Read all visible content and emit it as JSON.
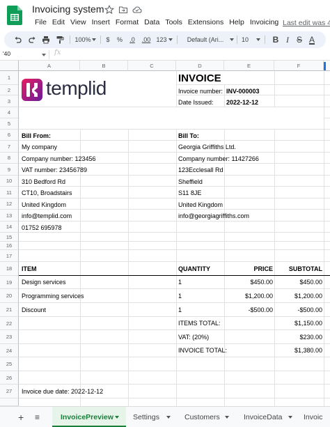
{
  "app": {
    "doc_title": "Invoicing system",
    "last_edit": "Last edit was 4",
    "menu": [
      "File",
      "Edit",
      "View",
      "Insert",
      "Format",
      "Data",
      "Tools",
      "Extensions",
      "Help",
      "Invoicing"
    ]
  },
  "toolbar": {
    "zoom": "100%",
    "currency": "$",
    "percent": "%",
    "dec_less": ".0",
    "dec_more": ".00",
    "number_format": "123",
    "font": "Default (Ari...",
    "font_size": "10",
    "bold": "B",
    "italic": "I",
    "strike": "S",
    "text_color": "A"
  },
  "formula_bar": {
    "name_box": "'40",
    "fx": "fx"
  },
  "columns": [
    "A",
    "B",
    "C",
    "D",
    "E",
    "F"
  ],
  "rows": [
    "1",
    "2",
    "3",
    "4",
    "5",
    "6",
    "7",
    "8",
    "9",
    "10",
    "11",
    "12",
    "13",
    "14",
    "15",
    "16",
    "17",
    "18",
    "19",
    "20",
    "21",
    "22",
    "23",
    "24",
    "25",
    "26",
    "27"
  ],
  "invoice": {
    "logo_text": "templid",
    "heading": "INVOICE",
    "number_label": "Invoice number:",
    "number_value": "INV-000003",
    "date_label": "Date Issued:",
    "date_value": "2022-12-12",
    "bill_from_label": "Bill From:",
    "bill_from": [
      "My company",
      "Company number: 123456",
      "VAT number: 23456789",
      "310 Bedford Rd",
      "CT10, Broadstairs",
      "United Kingdom",
      "info@templid.com",
      "01752 695978"
    ],
    "bill_to_label": "Bill To:",
    "bill_to": [
      "Georgia Griffiths Ltd.",
      "Company number: 11427266",
      "123Ecclesall Rd",
      "Sheffield",
      "S11 8JE",
      "United Kingdom",
      "info@georgiagriffiths.com"
    ],
    "headers": {
      "item": "ITEM",
      "quantity": "QUANTITY",
      "price": "PRICE",
      "subtotal": "SUBTOTAL"
    },
    "items": [
      {
        "item": "Design services",
        "quantity": "1",
        "price": "$450.00",
        "subtotal": "$450.00"
      },
      {
        "item": "Programming services",
        "quantity": "1",
        "price": "$1,200.00",
        "subtotal": "$1,200.00"
      },
      {
        "item": "Discount",
        "quantity": "1",
        "price": "-$500.00",
        "subtotal": "-$500.00"
      }
    ],
    "items_total_label": "ITEMS TOTAL:",
    "items_total": "$1,150.00",
    "vat_label": "VAT: (20%)",
    "vat": "$230.00",
    "invoice_total_label": "INVOICE TOTAL:",
    "invoice_total": "$1,380.00",
    "due_date": "Invoice due date: 2022-12-12"
  },
  "tabs": {
    "add": "+",
    "list": "≡",
    "sheets": [
      "InvoicePreview",
      "Settings",
      "Customers",
      "InvoiceData",
      "Invoic"
    ]
  },
  "colors": {
    "sheets_green": "#188038",
    "logo_magenta": "#c2185b",
    "logo_purple": "#6a1b9a",
    "accent_blue": "#1a73e8"
  }
}
